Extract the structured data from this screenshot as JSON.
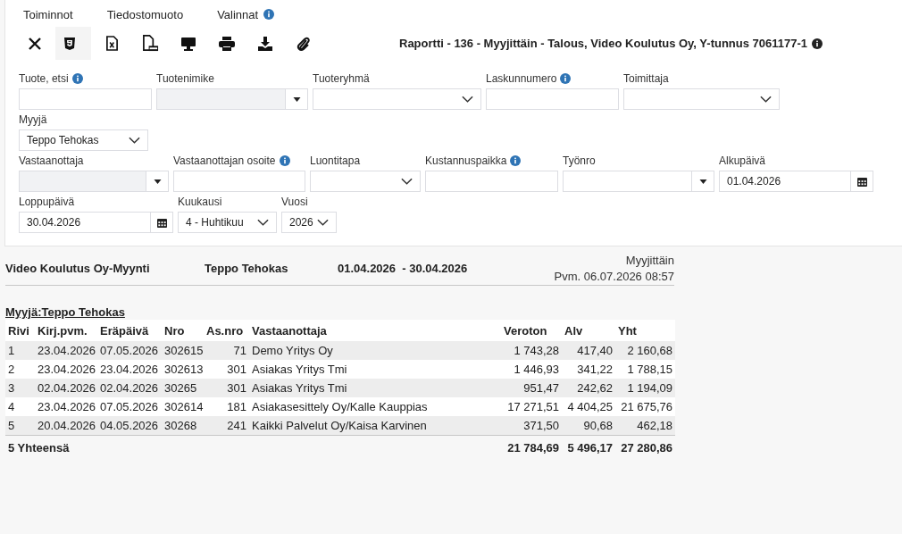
{
  "menu": [
    {
      "label": "Toiminnot",
      "info": false
    },
    {
      "label": "Tiedostomuoto",
      "info": false
    },
    {
      "label": "Valinnat",
      "info": true
    }
  ],
  "toolbar": [
    {
      "kind": "close",
      "selected": false
    },
    {
      "kind": "html",
      "selected": true
    },
    {
      "kind": "excel",
      "selected": false
    },
    {
      "kind": "pdf",
      "selected": false
    },
    {
      "kind": "screen",
      "selected": false
    },
    {
      "kind": "print",
      "selected": false
    },
    {
      "kind": "download",
      "selected": false
    },
    {
      "kind": "attach",
      "selected": false
    }
  ],
  "report_title": "Raportti - 136 - Myyjittäin - Talous, Video Koulutus Oy, Y-tunnus 7061177-1",
  "filter_rows": [
    [
      {
        "label": "Tuote, etsi",
        "info": true,
        "kind": "text"
      },
      {
        "label": "Tuotenimike",
        "info": false,
        "kind": "combo",
        "disabled": true
      },
      {
        "label": "Tuoteryhmä",
        "info": false,
        "kind": "select"
      },
      {
        "label": "Laskunnumero",
        "info": true,
        "kind": "text"
      },
      {
        "label": "Toimittaja",
        "info": false,
        "kind": "select"
      }
    ],
    [
      {
        "label": "Myyjä",
        "info": false,
        "kind": "select",
        "value": "Teppo Tehokas"
      }
    ],
    [
      {
        "label": "Vastaanottaja",
        "info": false,
        "kind": "combo",
        "disabled": true
      },
      {
        "label": "Vastaanottajan osoite",
        "info": true,
        "kind": "text"
      },
      {
        "label": "Luontitapa",
        "info": false,
        "kind": "select"
      },
      {
        "label": "Kustannuspaikka",
        "info": true,
        "kind": "text"
      },
      {
        "label": "Työnro",
        "info": false,
        "kind": "combo",
        "disabled": false
      },
      {
        "label": "Alkupäivä",
        "info": false,
        "kind": "date",
        "value": "01.04.2026"
      }
    ],
    [
      {
        "label": "Loppupäivä",
        "info": false,
        "kind": "date",
        "value": "30.04.2026"
      },
      {
        "label": "Kuukausi",
        "info": false,
        "kind": "select",
        "value": "4 - Huhtikuu"
      },
      {
        "label": "Vuosi",
        "info": false,
        "kind": "select",
        "value": "2026"
      }
    ]
  ],
  "report": {
    "company": "Video Koulutus Oy-Myynti",
    "seller": "Teppo Tehokas",
    "period": "01.04.2026  - 30.04.2026",
    "type": "Myyjittäin",
    "date": "Pvm. 06.07.2026 08:57",
    "group_title": "Myyjä:Teppo Tehokas",
    "columns": [
      "Rivi",
      "Kirj.pvm.",
      "Eräpäivä",
      "Nro",
      "As.nro",
      "Vastaanottaja",
      "Veroton",
      "Alv",
      "Yht"
    ],
    "rows": [
      [
        "1",
        "23.04.2026",
        "07.05.2026",
        "302615",
        "71",
        "Demo Yritys Oy",
        "1 743,28",
        "417,40",
        "2 160,68"
      ],
      [
        "2",
        "23.04.2026",
        "23.04.2026",
        "302613",
        "301",
        "Asiakas Yritys Tmi",
        "1 446,93",
        "341,22",
        "1 788,15"
      ],
      [
        "3",
        "02.04.2026",
        "02.04.2026",
        "30265",
        "301",
        "Asiakas Yritys Tmi",
        "951,47",
        "242,62",
        "1 194,09"
      ],
      [
        "4",
        "23.04.2026",
        "07.05.2026",
        "302614",
        "181",
        "Asiakasesittely Oy/Kalle Kauppias",
        "17 271,51",
        "4 404,25",
        "21 675,76"
      ],
      [
        "5",
        "20.04.2026",
        "04.05.2026",
        "30268",
        "241",
        "Kaikki Palvelut Oy/Kaisa Karvinen",
        "371,50",
        "90,68",
        "462,18"
      ]
    ],
    "total": {
      "label": "5 Yhteensä",
      "veroton": "21 784,69",
      "alv": "5 496,17",
      "yht": "27 280,86"
    }
  }
}
